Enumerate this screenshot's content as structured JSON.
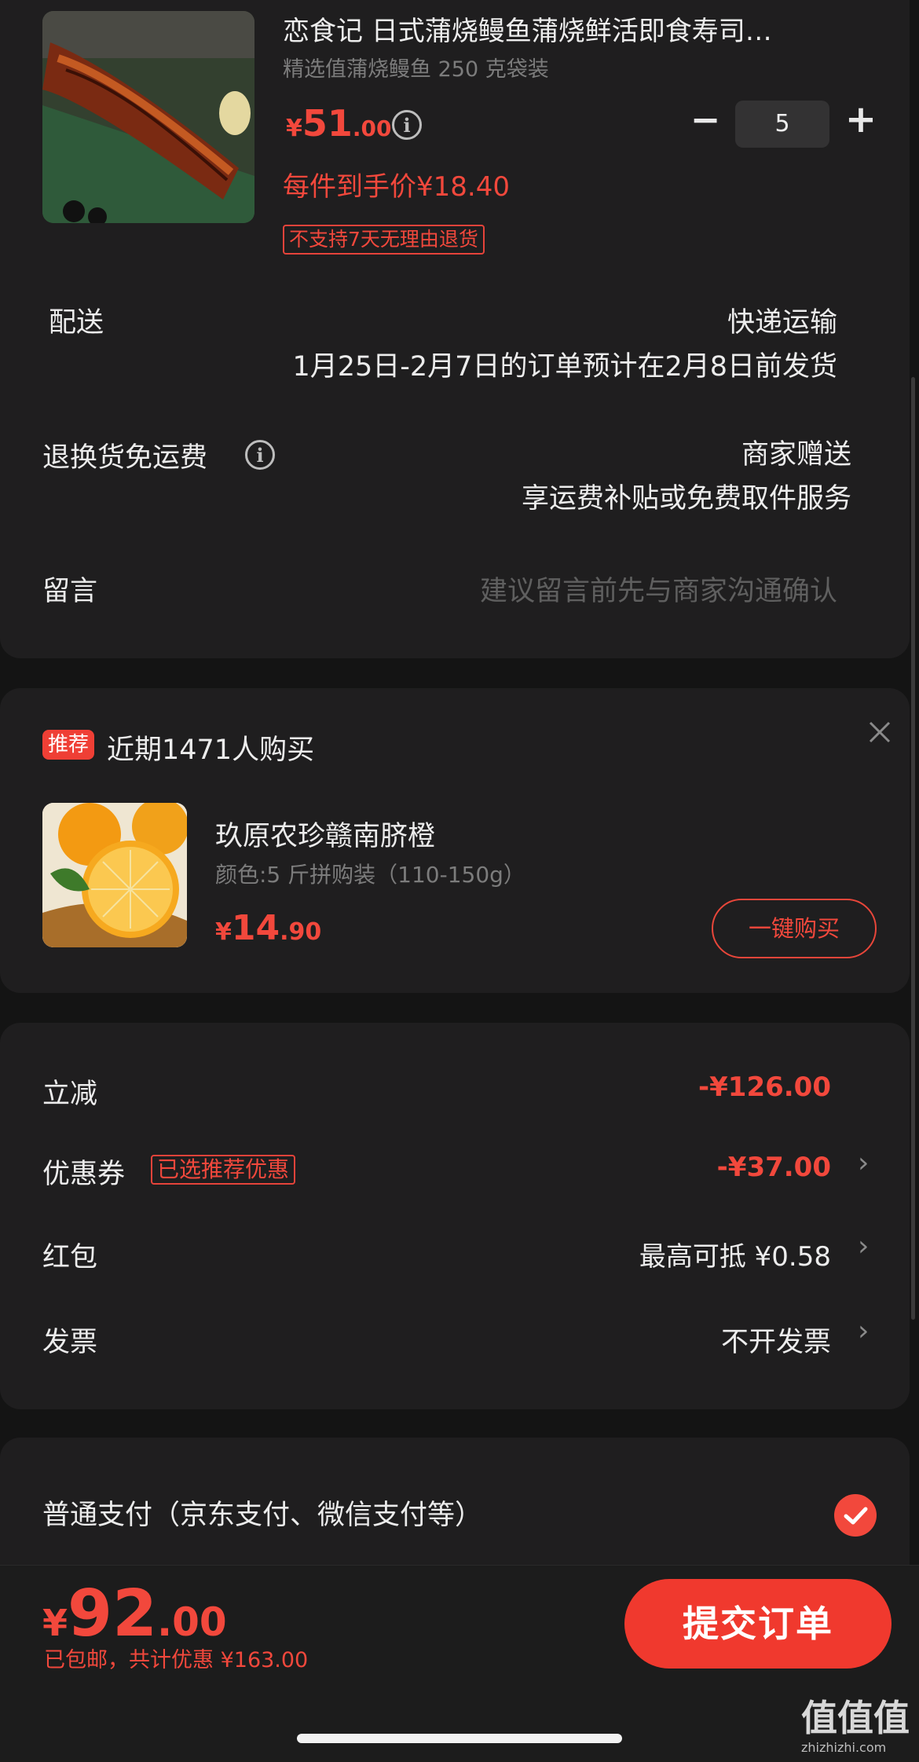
{
  "product": {
    "title": "恋食记 日式蒲烧鳗鱼蒲烧鲜活即食寿司…",
    "spec": "精选值蒲烧鳗鱼 250 克袋装",
    "price_symbol": "¥",
    "price_int": "51",
    "price_dec": ".00",
    "unit_price": "每件到手价¥18.40",
    "return_tag": "不支持7天无理由退货",
    "quantity": "5",
    "minus": "−",
    "plus": "+"
  },
  "delivery": {
    "label": "配送",
    "method": "快递运输",
    "note": "1月25日-2月7日的订单预计在2月8日前发货"
  },
  "return_shipping": {
    "label": "退换货免运费",
    "value": "商家赠送",
    "note": "享运费补贴或免费取件服务"
  },
  "message": {
    "label": "留言",
    "placeholder": "建议留言前先与商家沟通确认"
  },
  "recommend": {
    "badge": "推荐",
    "headline": "近期1471人购买",
    "name": "玖原农珍赣南脐橙",
    "spec": "颜色:5 斤拼购装（110-150g）",
    "price_symbol": "¥",
    "price_int": "14",
    "price_dec": ".90",
    "buy_label": "一键购买"
  },
  "discounts": {
    "instant": {
      "label": "立减",
      "value": "-¥126.00"
    },
    "coupon": {
      "label": "优惠券",
      "tag": "已选推荐优惠",
      "value": "-¥37.00"
    },
    "red_packet": {
      "label": "红包",
      "value": "最高可抵 ¥0.58"
    },
    "invoice": {
      "label": "发票",
      "value": "不开发票"
    }
  },
  "payment": {
    "label": "普通支付（京东支付、微信支付等）"
  },
  "footer": {
    "total_symbol": "¥",
    "total_int": "92",
    "total_dec": ".00",
    "summary": "已包邮，共计优惠 ¥163.00",
    "submit_label": "提交订单"
  },
  "watermark": {
    "brand": "值值值",
    "url": "zhizhizhi.com"
  },
  "colors": {
    "accent": "#f2483c",
    "background": "#141414",
    "card": "#1f1e1f"
  }
}
